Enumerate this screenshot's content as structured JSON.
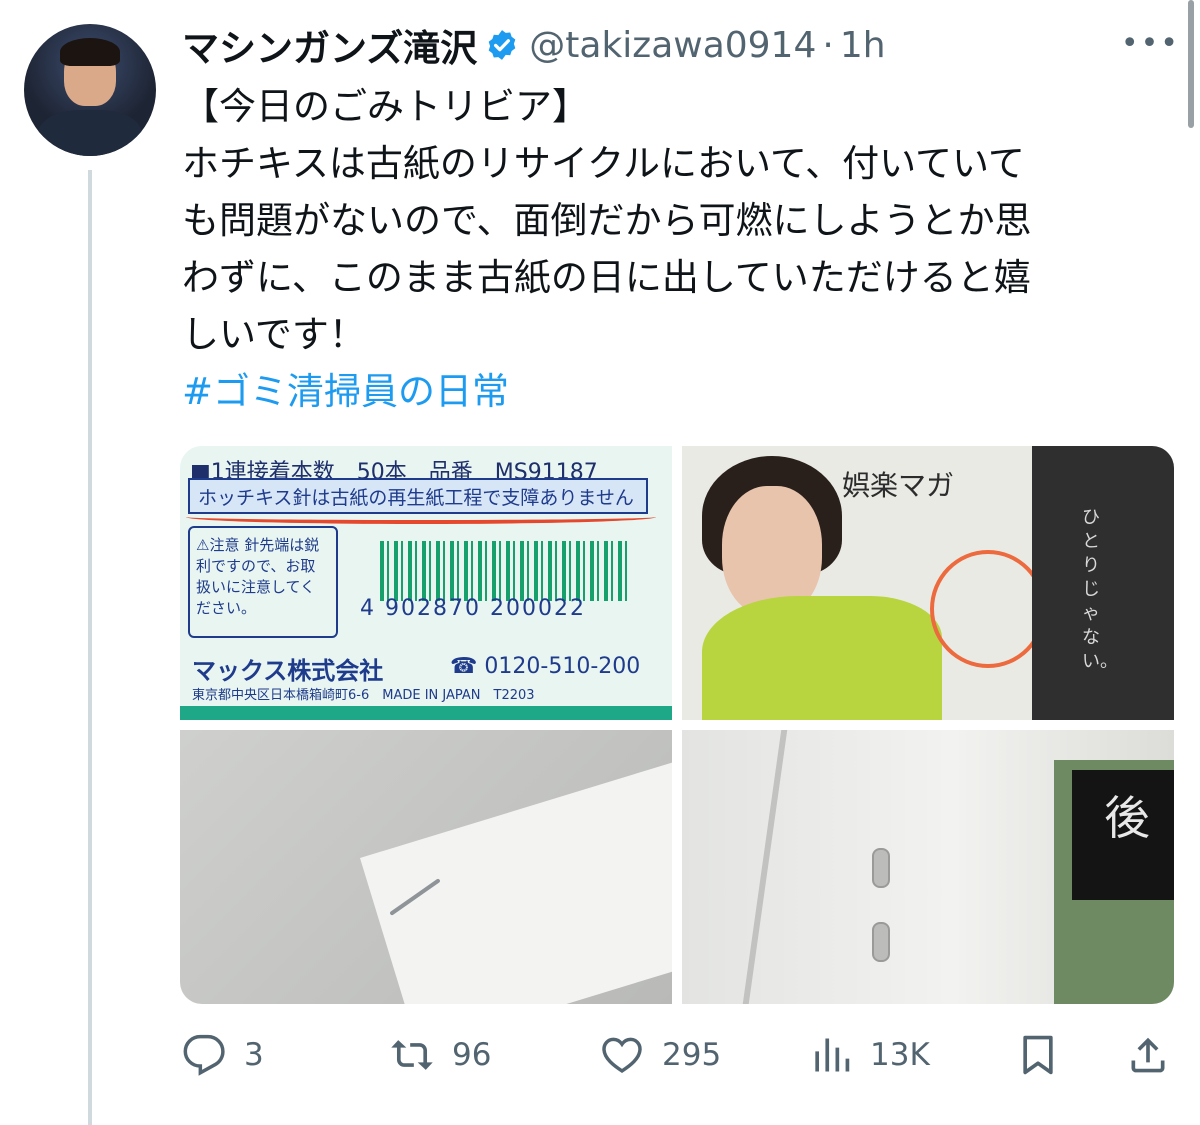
{
  "post": {
    "display_name": "マシンガンズ滝沢",
    "handle": "@takizawa0914",
    "separator": "·",
    "time": "1h",
    "more_label": "•••",
    "text_lines": [
      "【今日のごみトリビア】",
      "ホチキスは古紙のリサイクルにおいて、付いていて",
      "も問題がないので、面倒だから可燃にしようとか思",
      "わずに、このまま古紙の日に出していただけると嬉",
      "しいです！"
    ],
    "hashtag": "#ゴミ清掃員の日常"
  },
  "images": {
    "package": {
      "top_line": "■1連接着本数　50本　品番　MS91187",
      "notice": "ホッチキス針は古紙の再生紙工程で支障ありません",
      "caution": "⚠注意 針先端は鋭利ですので、お取扱いに注意してください。",
      "barcode_digits": "4 902870 200022",
      "maker": "マックス株式会社",
      "phone": "☎ 0120-510-200",
      "address": "東京都中央区日本橋箱崎町6-6　MADE IN JAPAN　T2203"
    },
    "magazine": {
      "title": "娯楽マガ",
      "vertical_text": "ひとりじゃない。"
    },
    "closeup": {
      "label": "後"
    }
  },
  "actions": {
    "replies": "3",
    "reposts": "96",
    "likes": "295",
    "views": "13K"
  },
  "colors": {
    "link": "#1d9bf0",
    "verified": "#1d9bf0",
    "muted": "#536471",
    "text": "#0f1419"
  },
  "icons": [
    "verified-badge-icon",
    "reply-icon",
    "repost-icon",
    "like-icon",
    "views-icon",
    "bookmark-icon",
    "share-icon",
    "more-icon"
  ]
}
